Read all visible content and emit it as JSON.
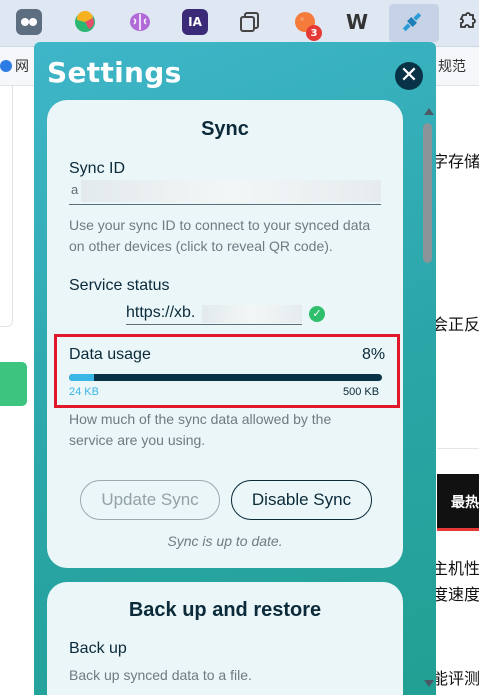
{
  "toolbar": {
    "extensions": [
      {
        "name": "extension-1-icon"
      },
      {
        "name": "extension-2-icon"
      },
      {
        "name": "brain-extension-icon"
      },
      {
        "name": "ia-extension-icon",
        "text": "IA"
      },
      {
        "name": "copy-extension-icon"
      },
      {
        "name": "cookie-extension-icon",
        "badge": "3"
      },
      {
        "name": "w-extension-icon",
        "text": "W"
      },
      {
        "name": "satellite-extension-icon"
      },
      {
        "name": "puzzle-extensions-icon"
      }
    ]
  },
  "bookmarks": {
    "left_text": "网",
    "right_text": "规范"
  },
  "background": {
    "texts": [
      "字存储",
      "会正反",
      "主机性",
      "度速度",
      "能评测"
    ],
    "black_label": "最热"
  },
  "popup": {
    "title": "Settings",
    "close_symbol": "✕",
    "sync": {
      "title": "Sync",
      "sync_id_label": "Sync ID",
      "sync_id_prefix": "a",
      "sync_id_help_1": "Use your sync ID to connect to your synced data",
      "sync_id_help_2": "on other devices (click to reveal QR code).",
      "service_status_label": "Service status",
      "service_url": "https://xb.",
      "status_ok_symbol": "✓",
      "data_usage_label": "Data usage",
      "data_usage_percent": "8%",
      "data_usage_fraction": 0.08,
      "used_label": "24 KB",
      "limit_label": "500 KB",
      "usage_help_1": "How much of the sync data allowed by the",
      "usage_help_2": "service are you using.",
      "update_button": "Update Sync",
      "disable_button": "Disable Sync",
      "sync_status": "Sync is up to date."
    },
    "backup": {
      "title": "Back up and restore",
      "backup_label": "Back up",
      "backup_help": "Back up synced data to a file."
    }
  },
  "colors": {
    "popup_bg": "#2aa6a8",
    "card_bg": "#eaf6f7",
    "dark_text": "#0b2a3a",
    "usage_fill": "#3ab6e6",
    "highlight": "#e0182a"
  }
}
